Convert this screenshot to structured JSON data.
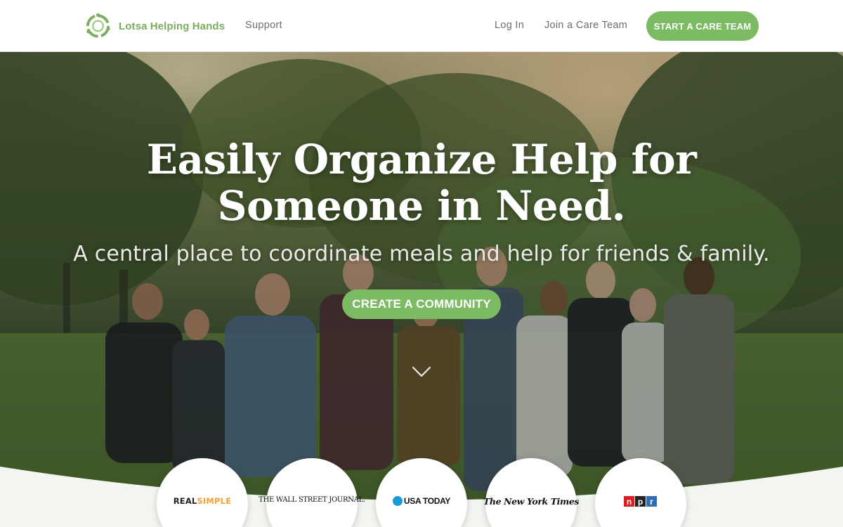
{
  "header": {
    "brand": "Lotsa Helping Hands",
    "nav": {
      "support": "Support",
      "login": "Log In",
      "join": "Join a Care Team"
    },
    "start_button": "START A CARE TEAM"
  },
  "hero": {
    "title": "Easily Organize Help for Someone in Need.",
    "subtitle": "A central place to coordinate meals and help for friends & family.",
    "cta": "CREATE A COMMUNITY",
    "scroll_icon": "chevron-down-icon"
  },
  "press": {
    "logos": [
      {
        "name": "REAL SIMPLE",
        "part1": "REAL",
        "part2": "SIMPLE"
      },
      {
        "name": "THE WALL STREET JOURNAL.",
        "text": "THE WALL STREET JOURNAL."
      },
      {
        "name": "USA TODAY",
        "text": "USA TODAY"
      },
      {
        "name": "The New York Times",
        "text": "The New York Times"
      },
      {
        "name": "npr",
        "letters": [
          "n",
          "p",
          "r"
        ]
      }
    ]
  },
  "colors": {
    "brand_green": "#7bae5e",
    "button_green": "#7dba64",
    "npr_red": "#d62021",
    "npr_black": "#222222",
    "npr_blue": "#2f6db5",
    "usa_today_blue": "#1a9ad6",
    "real_simple_orange": "#f2a13a"
  }
}
